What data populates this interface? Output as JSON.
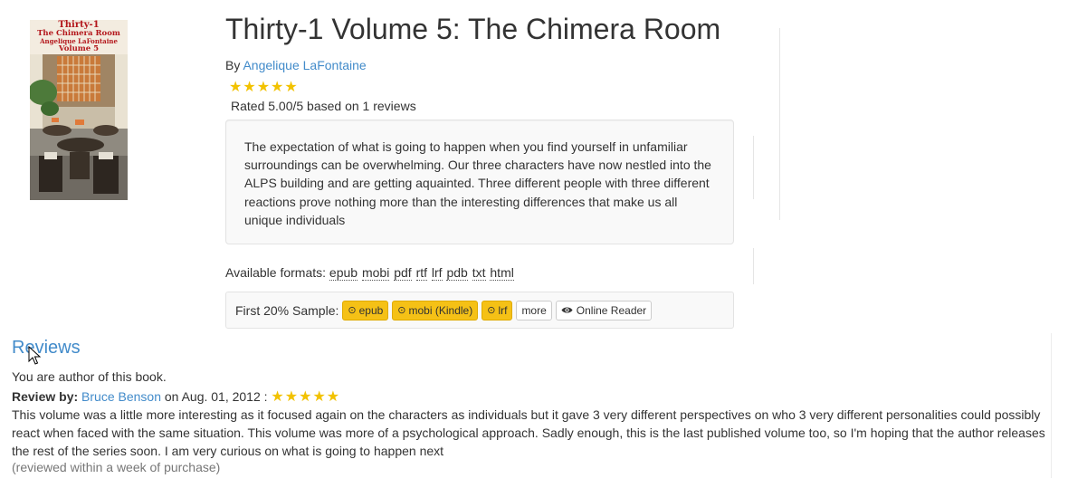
{
  "book": {
    "cover": {
      "line1": "Thirty-1",
      "line2": "The Chimera Room",
      "line3": "Angelique LaFontaine",
      "line4": "Volume 5"
    },
    "title": "Thirty-1 Volume 5: The Chimera Room",
    "by_prefix": "By",
    "author": "Angelique LaFontaine",
    "stars": "★★★★★",
    "rating_text": "Rated 5.00/5 based on 1 reviews",
    "description": "The expectation of what is going to happen when you find yourself in unfamiliar surroundings can be overwhelming. Our three characters have now nestled into the ALPS building and are getting aquainted. Three different people with three different reactions prove nothing more than the interesting differences that make us all unique individuals"
  },
  "formats": {
    "label": "Available formats:",
    "items": [
      "epub",
      "mobi",
      "pdf",
      "rtf",
      "lrf",
      "pdb",
      "txt",
      "html"
    ]
  },
  "sample": {
    "label": "First 20% Sample:",
    "buttons": {
      "epub": "epub",
      "mobi": "mobi (Kindle)",
      "lrf": "lrf",
      "more": "more",
      "reader": "Online Reader"
    }
  },
  "reviews": {
    "heading": "Reviews",
    "author_note": "You are author of this book.",
    "review_by_label": "Review by:",
    "reviewer": "Bruce Benson",
    "date_text": "on Aug. 01, 2012 :",
    "stars": "★★★★★",
    "text": "This volume was a little more interesting as it focused again on the characters as individuals but it gave 3 very different perspectives on who 3 very different personalities could possibly react when faced with the same situation. This volume was more of a psychological approach. Sadly enough, this is the last published volume too, so I'm hoping that the author releases the rest of the series soon. I am very curious on what is going to happen next",
    "note": "(reviewed within a week of purchase)"
  },
  "colors": {
    "link": "#428bca",
    "star": "#f2c200",
    "sample_button": "#f5c116"
  }
}
